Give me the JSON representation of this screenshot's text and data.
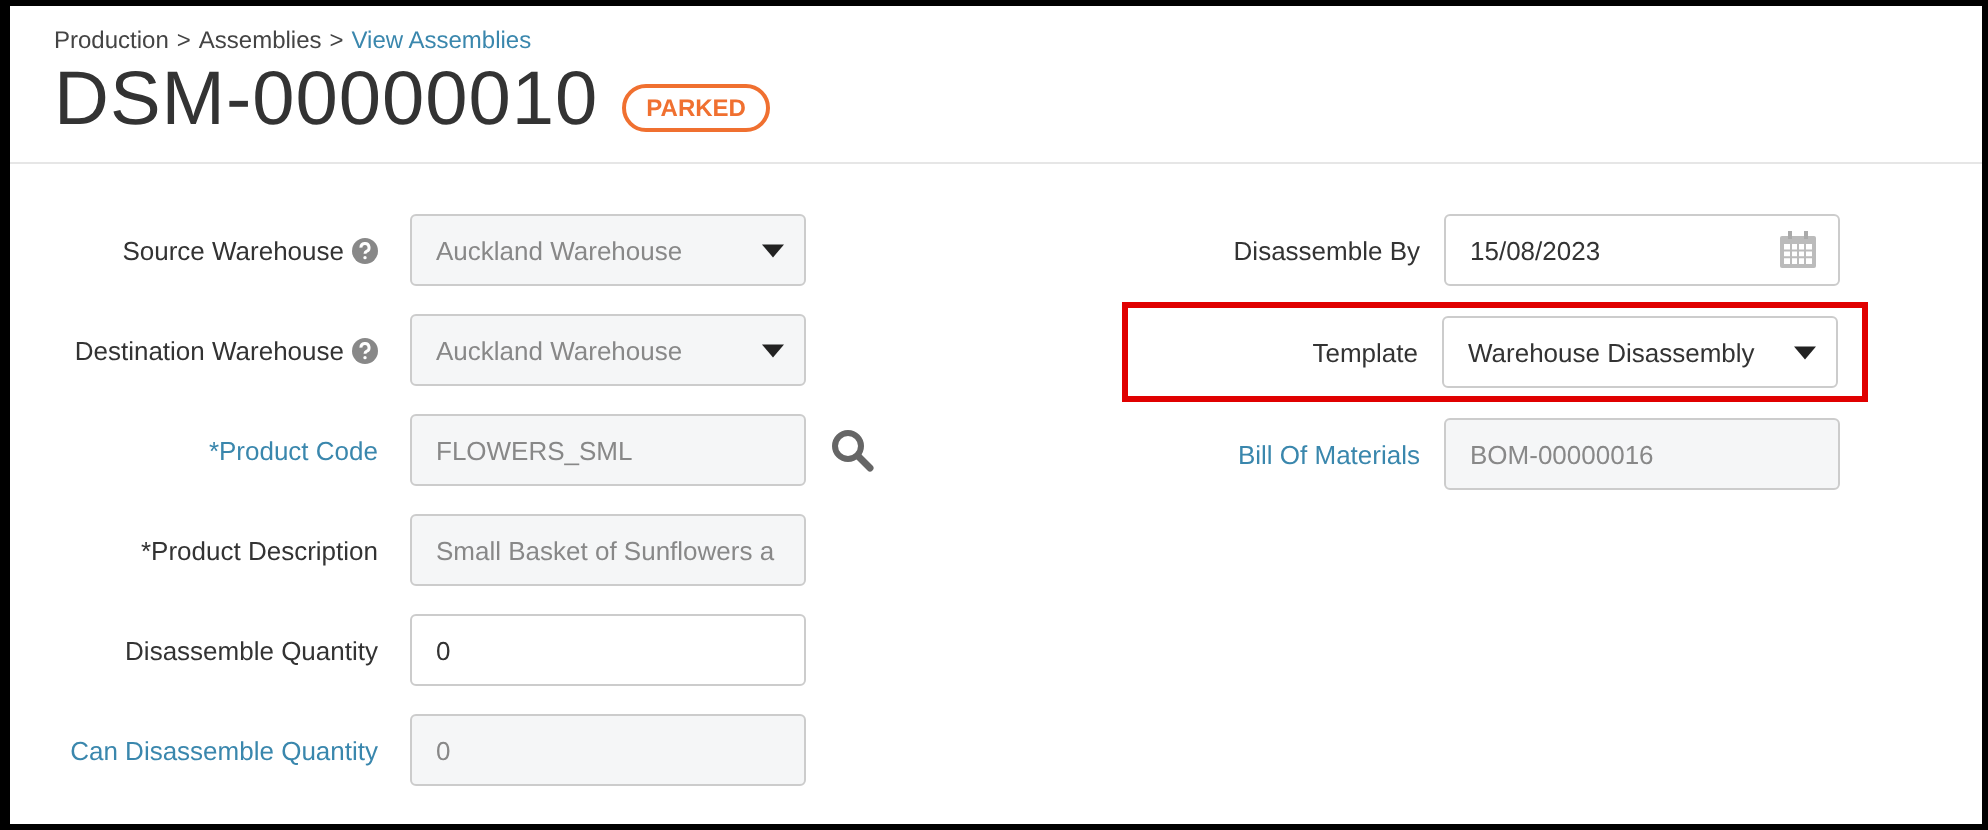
{
  "breadcrumb": [
    {
      "label": "Production",
      "link": false
    },
    {
      "label": "Assemblies",
      "link": false
    },
    {
      "label": "View Assemblies",
      "link": true
    }
  ],
  "breadcrumb_separator": ">",
  "title": "DSM-00000010",
  "status": "PARKED",
  "left_fields": [
    {
      "label": "Source Warehouse",
      "kind": "select",
      "value": "Auckland Warehouse",
      "disabled": true,
      "help": true,
      "link": false,
      "search": false,
      "highlighted": false
    },
    {
      "label": "Destination Warehouse",
      "kind": "select",
      "value": "Auckland Warehouse",
      "disabled": true,
      "help": true,
      "link": false,
      "search": false,
      "highlighted": false
    },
    {
      "label": "*Product Code",
      "kind": "input",
      "value": "FLOWERS_SML",
      "disabled": true,
      "help": false,
      "link": true,
      "search": true,
      "highlighted": false
    },
    {
      "label": "*Product Description",
      "kind": "input",
      "value": "Small Basket of Sunflowers a",
      "disabled": true,
      "help": false,
      "link": false,
      "search": false,
      "highlighted": false
    },
    {
      "label": "Disassemble Quantity",
      "kind": "input",
      "value": "0",
      "disabled": false,
      "help": false,
      "link": false,
      "search": false,
      "highlighted": false
    },
    {
      "label": "Can Disassemble Quantity",
      "kind": "input",
      "value": "0",
      "disabled": true,
      "help": false,
      "link": true,
      "search": false,
      "highlighted": false
    }
  ],
  "right_fields": [
    {
      "label": "Disassemble By",
      "kind": "date",
      "value": "15/08/2023",
      "disabled": false,
      "help": false,
      "link": false,
      "search": false,
      "highlighted": false
    },
    {
      "label": "Template",
      "kind": "select",
      "value": "Warehouse Disassembly",
      "disabled": false,
      "help": false,
      "link": false,
      "search": false,
      "highlighted": true
    },
    {
      "label": "Bill Of Materials",
      "kind": "input",
      "value": "BOM-00000016",
      "disabled": true,
      "help": false,
      "link": true,
      "search": false,
      "highlighted": false
    }
  ]
}
